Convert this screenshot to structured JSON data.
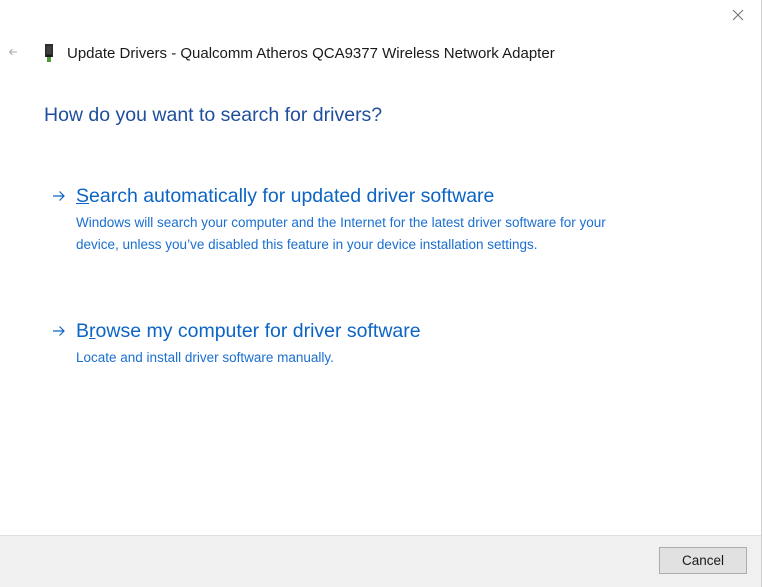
{
  "window": {
    "title": "Update Drivers - Qualcomm Atheros QCA9377 Wireless Network Adapter",
    "close_icon": "close-icon",
    "back_icon": "back-arrow-icon",
    "device_icon": "network-adapter-icon"
  },
  "heading": "How do you want to search for drivers?",
  "options": [
    {
      "accel": "S",
      "title_rest": "earch automatically for updated driver software",
      "description": "Windows will search your computer and the Internet for the latest driver software for your device, unless you’ve disabled this feature in your device installation settings.",
      "icon": "arrow-right-icon"
    },
    {
      "prefix": "B",
      "accel": "r",
      "title_rest": "owse my computer for driver software",
      "description": "Locate and install driver software manually.",
      "icon": "arrow-right-icon"
    }
  ],
  "footer": {
    "cancel_label": "Cancel"
  },
  "colors": {
    "heading": "#1f4e9c",
    "link": "#0c64c4",
    "footer_bg": "#f0f0f0"
  }
}
